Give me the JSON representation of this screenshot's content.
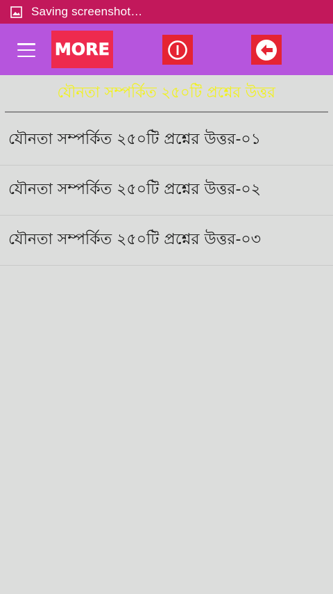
{
  "status_bar": {
    "text": "Saving screenshot…",
    "icon": "image-icon",
    "background": "#c2185b"
  },
  "app_bar": {
    "background": "#b655dd",
    "menu_icon": "hamburger-menu-icon",
    "more_label": "MORE",
    "power_icon": "power-icon",
    "back_icon": "back-arrow-icon",
    "button_color": "#e52433",
    "more_color": "#ee2a4e"
  },
  "header": {
    "title": "যৌনতা সম্পর্কিত ২৫০টি প্রশ্নের উত্তর",
    "title_color": "#f2f21a"
  },
  "list": {
    "items": [
      {
        "label": "যৌনতা সম্পর্কিত ২৫০টি প্রশ্নের উত্তর-০১"
      },
      {
        "label": "যৌনতা সম্পর্কিত ২৫০টি প্রশ্নের উত্তর-০২"
      },
      {
        "label": "যৌনতা সম্পর্কিত ২৫০টি প্রশ্নের উত্তর-০৩"
      }
    ]
  }
}
